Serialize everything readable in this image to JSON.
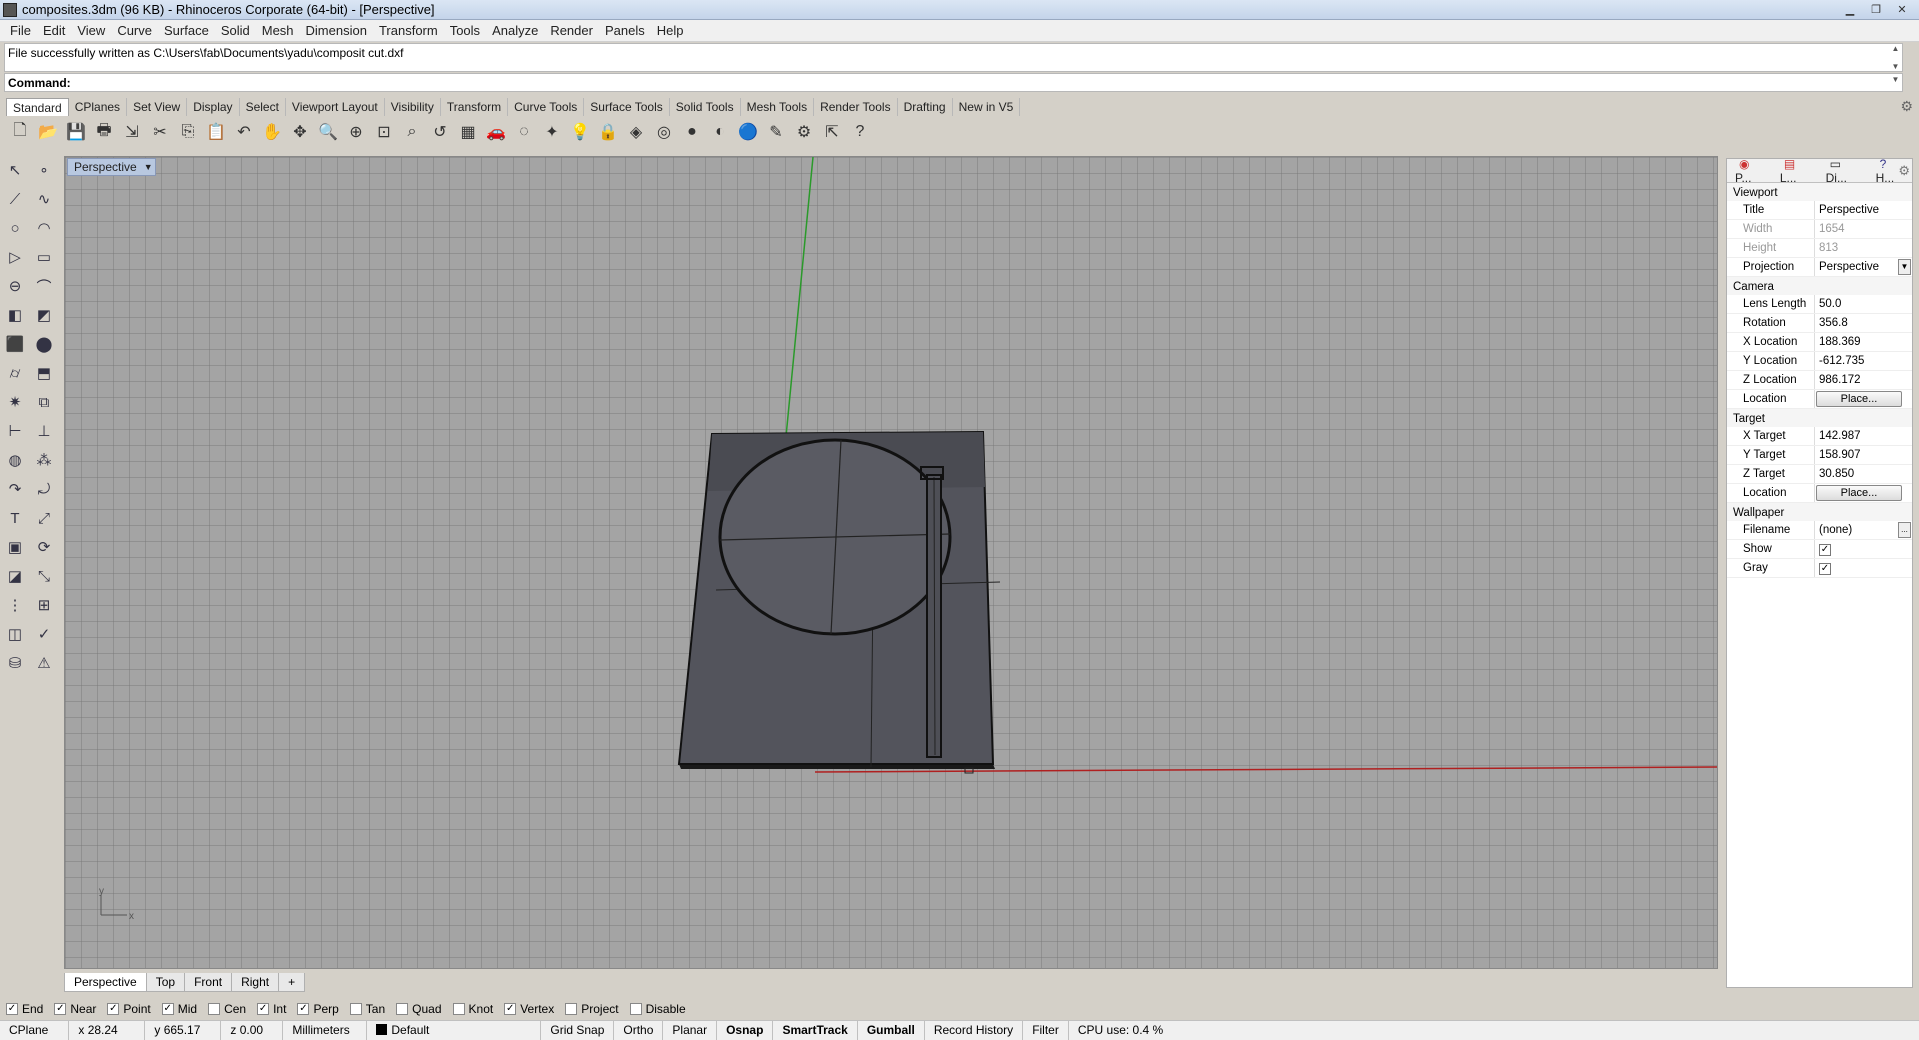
{
  "window": {
    "title": "composites.3dm (96 KB) - Rhinoceros Corporate (64-bit) - [Perspective]"
  },
  "menu": [
    "File",
    "Edit",
    "View",
    "Curve",
    "Surface",
    "Solid",
    "Mesh",
    "Dimension",
    "Transform",
    "Tools",
    "Analyze",
    "Render",
    "Panels",
    "Help"
  ],
  "command": {
    "history": "File successfully written as C:\\Users\\fab\\Documents\\yadu\\composit cut.dxf",
    "prompt": "Command:"
  },
  "toolbar_tabs": [
    "Standard",
    "CPlanes",
    "Set View",
    "Display",
    "Select",
    "Viewport Layout",
    "Visibility",
    "Transform",
    "Curve Tools",
    "Surface Tools",
    "Solid Tools",
    "Mesh Tools",
    "Render Tools",
    "Drafting",
    "New in V5"
  ],
  "toolbar_icons": [
    "new",
    "open",
    "save",
    "print",
    "import",
    "cut",
    "copy",
    "paste",
    "undo",
    "pan",
    "rotate-view",
    "zoom",
    "zoom-window",
    "zoom-extents",
    "zoom-selected",
    "undo-view",
    "four-viewports",
    "car-render",
    "circle-select",
    "object-properties",
    "light",
    "lock",
    "material",
    "color-wheel",
    "sphere",
    "shaded-sphere",
    "blue-sphere",
    "options",
    "gear",
    "flow",
    "help"
  ],
  "left_tools": [
    "select",
    "point",
    "polyline",
    "curve",
    "circle",
    "arc",
    "triangle",
    "rectangle",
    "ellipse",
    "fillet",
    "surface",
    "sweep",
    "box",
    "sphere",
    "cylinder",
    "extrude",
    "explode",
    "boolean",
    "dimension",
    "gumball",
    "sphere-solid",
    "array",
    "curve-tool",
    "offset",
    "text",
    "move",
    "group",
    "rotate",
    "box-tool",
    "scale",
    "grid",
    "align",
    "mirror",
    "check",
    "layers",
    "light-tool"
  ],
  "viewport": {
    "label": "Perspective",
    "axis_y": "y",
    "axis_x": "x"
  },
  "view_tabs": [
    "Perspective",
    "Top",
    "Front",
    "Right",
    "+"
  ],
  "osnaps": [
    {
      "label": "End",
      "checked": true
    },
    {
      "label": "Near",
      "checked": true
    },
    {
      "label": "Point",
      "checked": true
    },
    {
      "label": "Mid",
      "checked": true
    },
    {
      "label": "Cen",
      "checked": false
    },
    {
      "label": "Int",
      "checked": true
    },
    {
      "label": "Perp",
      "checked": true
    },
    {
      "label": "Tan",
      "checked": false
    },
    {
      "label": "Quad",
      "checked": false
    },
    {
      "label": "Knot",
      "checked": false
    },
    {
      "label": "Vertex",
      "checked": true
    },
    {
      "label": "Project",
      "checked": false
    },
    {
      "label": "Disable",
      "checked": false
    }
  ],
  "status": {
    "cplane": "CPlane",
    "x": "x 28.24",
    "y": "y 665.17",
    "z": "z 0.00",
    "units": "Millimeters",
    "layer": "Default",
    "grid_snap": "Grid Snap",
    "ortho": "Ortho",
    "planar": "Planar",
    "osnap": "Osnap",
    "smarttrack": "SmartTrack",
    "gumball": "Gumball",
    "record_history": "Record History",
    "filter": "Filter",
    "cpu": "CPU use: 0.4 %"
  },
  "panel": {
    "tabs": [
      "P...",
      "L...",
      "Di...",
      "H..."
    ],
    "viewport_section": "Viewport",
    "title_label": "Title",
    "title": "Perspective",
    "width_label": "Width",
    "width": "1654",
    "height_label": "Height",
    "height": "813",
    "projection_label": "Projection",
    "projection": "Perspective",
    "camera_section": "Camera",
    "lens_label": "Lens Length",
    "lens": "50.0",
    "rotation_label": "Rotation",
    "rotation": "356.8",
    "xloc_label": "X Location",
    "xloc": "188.369",
    "yloc_label": "Y Location",
    "yloc": "-612.735",
    "zloc_label": "Z Location",
    "zloc": "986.172",
    "location_label": "Location",
    "place_btn": "Place...",
    "target_section": "Target",
    "xt_label": "X Target",
    "xt": "142.987",
    "yt_label": "Y Target",
    "yt": "158.907",
    "zt_label": "Z Target",
    "zt": "30.850",
    "wallpaper_section": "Wallpaper",
    "filename_label": "Filename",
    "filename": "(none)",
    "browse_btn": "...",
    "show_label": "Show",
    "show_checked": true,
    "gray_label": "Gray",
    "gray_checked": true
  }
}
